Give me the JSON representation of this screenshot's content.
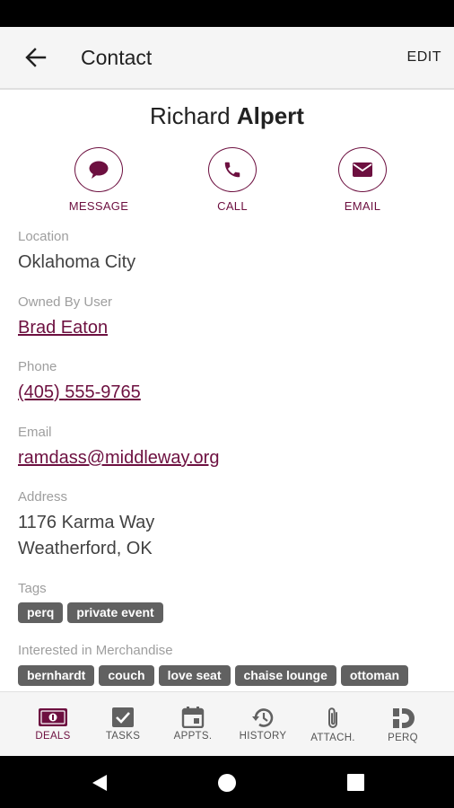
{
  "app_bar": {
    "title": "Contact",
    "edit_label": "EDIT"
  },
  "contact": {
    "first_name": "Richard",
    "last_name": "Alpert"
  },
  "actions": {
    "message": "MESSAGE",
    "call": "CALL",
    "email": "EMAIL"
  },
  "fields": {
    "location": {
      "label": "Location",
      "value": "Oklahoma City"
    },
    "owner": {
      "label": "Owned By User",
      "value": "Brad Eaton"
    },
    "phone": {
      "label": "Phone",
      "value": "(405) 555-9765"
    },
    "email": {
      "label": "Email",
      "value": "ramdass@middleway.org"
    },
    "address": {
      "label": "Address",
      "line1": "1176 Karma Way",
      "line2": "Weatherford, OK"
    }
  },
  "tags": {
    "label": "Tags",
    "items": [
      "perq",
      "private event"
    ]
  },
  "merchandise": {
    "label": "Interested in Merchandise",
    "items": [
      "bernhardt",
      "couch",
      "love seat",
      "chaise lounge",
      "ottoman"
    ]
  },
  "bottom_nav": {
    "items": [
      {
        "label": "DEALS",
        "icon": "deals-icon"
      },
      {
        "label": "TASKS",
        "icon": "tasks-icon"
      },
      {
        "label": "APPTS.",
        "icon": "calendar-icon"
      },
      {
        "label": "HISTORY",
        "icon": "history-icon"
      },
      {
        "label": "ATTACH.",
        "icon": "paperclip-icon"
      },
      {
        "label": "PERQ",
        "icon": "perq-icon"
      }
    ],
    "active": "DEALS"
  },
  "colors": {
    "accent": "#6d1040",
    "chip": "#616161",
    "label": "#9e9e9e",
    "text": "#424242"
  }
}
